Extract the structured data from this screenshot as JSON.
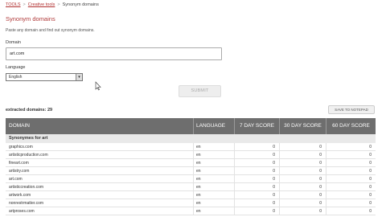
{
  "breadcrumb": {
    "tools": "TOOLS",
    "sep": ">",
    "creative": "Creative tools",
    "current": "Synonym domains"
  },
  "page": {
    "title": "Synonym domains",
    "description": "Paste any domain and find out synonym domains."
  },
  "form": {
    "domain_label": "Domain",
    "domain_value": "art.com",
    "language_label": "Language",
    "language_value": "English",
    "submit_label": "SUBMIT"
  },
  "results": {
    "extracted_label": "extracted domains: 29",
    "save_label": "SAVE TO NOTEPAD",
    "columns": [
      "DOMAIN",
      "LANGUAGE",
      "7 DAY SCORE",
      "30 DAY SCORE",
      "60 DAY SCORE"
    ],
    "group_label": "Synonymes for art",
    "rows": [
      {
        "domain": "graphics.com",
        "language": "en",
        "s7": "0",
        "s30": "0",
        "s60": "0"
      },
      {
        "domain": "artisticproduction.com",
        "language": "en",
        "s7": "0",
        "s30": "0",
        "s60": "0"
      },
      {
        "domain": "fineart.com",
        "language": "en",
        "s7": "0",
        "s30": "0",
        "s60": "0"
      },
      {
        "domain": "artistry.com",
        "language": "en",
        "s7": "0",
        "s30": "0",
        "s60": "0"
      },
      {
        "domain": "art.com",
        "language": "en",
        "s7": "0",
        "s30": "0",
        "s60": "0"
      },
      {
        "domain": "artisticcreation.com",
        "language": "en",
        "s7": "0",
        "s30": "0",
        "s60": "0"
      },
      {
        "domain": "artwork.com",
        "language": "en",
        "s7": "0",
        "s30": "0",
        "s60": "0"
      },
      {
        "domain": "nonrestrmatter.com",
        "language": "en",
        "s7": "0",
        "s30": "0",
        "s60": "0"
      },
      {
        "domain": "artproses.com",
        "language": "en",
        "s7": "0",
        "s30": "0",
        "s60": "0"
      }
    ]
  }
}
